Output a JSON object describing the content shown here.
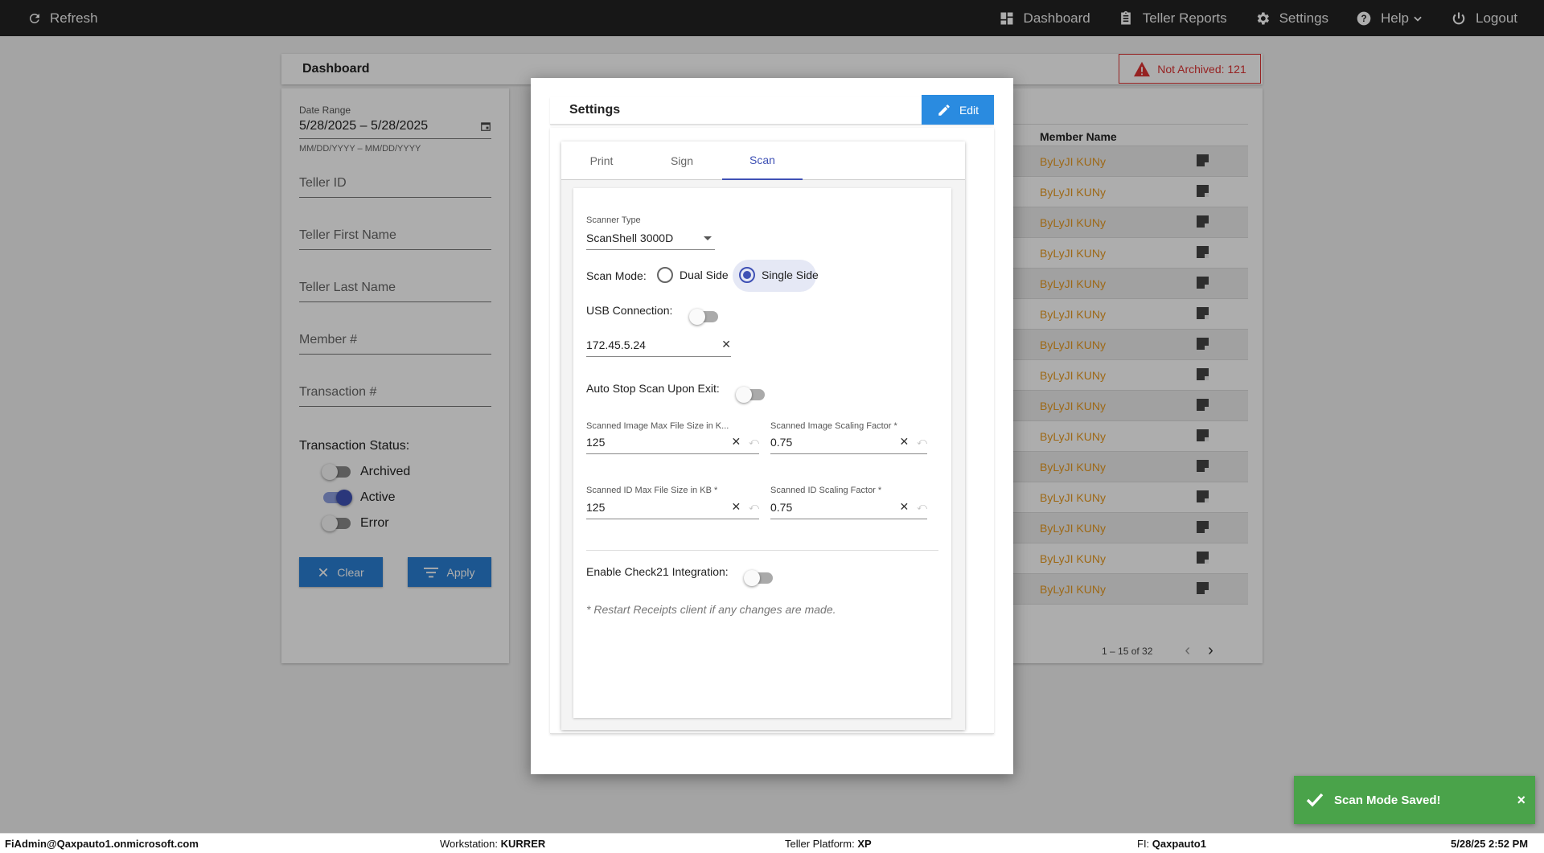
{
  "topbar": {
    "refresh_label": "Refresh",
    "nav": [
      {
        "label": "Dashboard",
        "icon": "dashboard-icon"
      },
      {
        "label": "Teller Reports",
        "icon": "clipboard-icon"
      },
      {
        "label": "Settings",
        "icon": "gear-icon"
      },
      {
        "label": "Help",
        "icon": "help-icon"
      },
      {
        "label": "Logout",
        "icon": "power-icon"
      }
    ]
  },
  "dashboard": {
    "title": "Dashboard",
    "not_archived": "Not Archived: 121",
    "filters": {
      "date_range_label": "Date Range",
      "date_range_value": "5/28/2025 – 5/28/2025",
      "date_hint": "MM/DD/YYYY – MM/DD/YYYY",
      "teller_id": "Teller ID",
      "teller_first": "Teller First Name",
      "teller_last": "Teller Last Name",
      "member_no": "Member #",
      "transaction_no": "Transaction #",
      "status_title": "Transaction Status:",
      "status_archived": "Archived",
      "status_active": "Active",
      "status_error": "Error",
      "clear_label": "Clear",
      "apply_label": "Apply"
    },
    "table": {
      "member_name_header": "Member Name",
      "rows": [
        "ByLyJI KUNy",
        "ByLyJI KUNy",
        "ByLyJI KUNy",
        "ByLyJI KUNy",
        "ByLyJI KUNy",
        "ByLyJI KUNy",
        "ByLyJI KUNy",
        "ByLyJI KUNy",
        "ByLyJI KUNy",
        "ByLyJI KUNy",
        "ByLyJI KUNy",
        "ByLyJI KUNy",
        "ByLyJI KUNy",
        "ByLyJI KUNy",
        "ByLyJI KUNy"
      ],
      "pagination": "1 – 15 of 32"
    }
  },
  "modal": {
    "title": "Settings",
    "edit_label": "Edit",
    "tabs": {
      "print": "Print",
      "sign": "Sign",
      "scan": "Scan",
      "active": "Scan"
    },
    "scan": {
      "scanner_type_label": "Scanner Type",
      "scanner_type_value": "ScanShell 3000D",
      "scan_mode_label": "Scan Mode:",
      "dual_side_label": "Dual Side",
      "single_side_label": "Single Side",
      "usb_label": "USB Connection:",
      "ip_value": "172.45.5.24",
      "auto_stop_label": "Auto Stop Scan Upon Exit:",
      "img_max_label": "Scanned Image Max File Size in K...",
      "img_max_value": "125",
      "img_scale_label": "Scanned Image Scaling Factor *",
      "img_scale_value": "0.75",
      "id_max_label": "Scanned ID Max File Size in KB *",
      "id_max_value": "125",
      "id_scale_label": "Scanned ID Scaling Factor *",
      "id_scale_value": "0.75",
      "check21_label": "Enable Check21 Integration:",
      "restart_note": "* Restart Receipts client if any changes are made."
    }
  },
  "snackbar": {
    "message": "Scan Mode Saved!",
    "close": "×"
  },
  "footer": {
    "user": "FiAdmin@Qaxpauto1.onmicrosoft.com",
    "workstation_label": "Workstation:",
    "workstation_value": "KURRER",
    "platform_label": "Teller Platform:",
    "platform_value": "XP",
    "fi_label": "FI:",
    "fi_value": "Qaxpauto1",
    "datetime": "5/28/25 2:52 PM"
  },
  "colors": {
    "accent": "#3f51b5",
    "edit_button": "#2a8be0",
    "link_orange": "#e89a1f",
    "snackbar": "#4aa34a",
    "alert_red": "#d33333"
  }
}
